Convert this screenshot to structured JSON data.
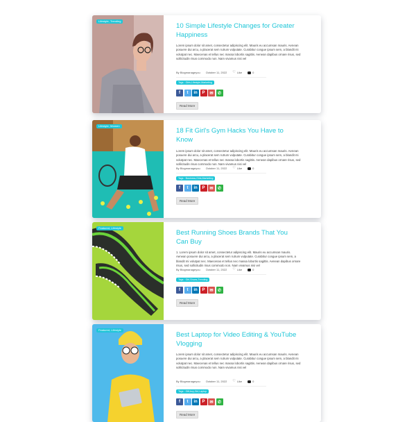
{
  "posts": [
    {
      "category": "Lifestyle, Trending",
      "title": "10 Simple Lifestyle Changes for Greater Happiness",
      "excerpt": "Lorem ipsum dolor sit amet, consectetur adipiscing elit. Mauris eu accumsan mauris. Aenean posuere dui arcu, a placerat sem rutrum vulputate. Curabitur congue ipsum sem, a blandit mi volutpat nec. Maecenas et tellus nec massa lobortis sagittis. Aenean dapibus ornare risus, sed sollicitudin risus commodo non. Nam vivamus nisi vel",
      "author": "By Blogmanageyou",
      "date": "October 11, 2022",
      "likes": "Like",
      "comments": "0",
      "tags": "Tags : Girls,Lifestyle,Marketing",
      "read_more": "Read More"
    },
    {
      "category": "Lifestyle, Women",
      "title": "18 Fit Girl's Gym Hacks You Have to Know",
      "excerpt": "Lorem ipsum dolor sit amet, consectetur adipiscing elit. Mauris eu accumsan mauris. Aenean posuere dui arcu, a placerat sem rutrum vulputate. Curabitur congue ipsum sem, a blandit mi volutpat nec. Maecenas et tellus nec massa lobortis sagittis. Aenean dapibus ornare risus, sed sollicitudin risus commodo non. Nam vivamus nisi vel",
      "author": "By Blogmanageyou",
      "date": "October 11, 2022",
      "likes": "Like",
      "comments": "0",
      "tags": "Tags : Business,Girls,Marketing",
      "read_more": "Read More"
    },
    {
      "category": "Featured, Lifestyle",
      "title": "Best Running Shoes Brands That You Can Buy",
      "excerpt": "1. Lorem ipsum dolor sit amet, consectetur adipiscing elit. Mauris eu accumsan mauris. Aenean posuere dui arcu, a placerat sem rutrum vulputate. Curabitur congue ipsum sem, a blandit mi volutpat nec. Maecenas et tellus nec massa lobortis sagittis. Aenean dapibus ornare risus, sed sollicitudin risus commodo non. Nam vivamus nisi vel",
      "author": "By Blogmanageyou",
      "date": "October 11, 2022",
      "likes": "Like",
      "comments": "0",
      "tags": "Tags : Girl,Shoes,Trending",
      "read_more": "Read More"
    },
    {
      "category": "Featured, Lifestyle",
      "title": "Best Laptop for Video Editing & YouTube Vlogging",
      "excerpt": "Lorem ipsum dolor sit amet, consectetur adipiscing elit. Mauris eu accumsan mauris. Aenean posuere dui arcu, a placerat sem rutrum vulputate. Curabitur congue ipsum sem, a blandit mi volutpat nec. Maecenas et tellus nec massa lobortis sagittis. Aenean dapibus ornare risus, sed sollicitudin risus commodo non. Nam vivamus nisi vel",
      "author": "By Blogmanageyou",
      "date": "October 11, 2022",
      "likes": "Like",
      "comments": "0",
      "tags": "Tags : Gift,buy,Girl,Laptop",
      "read_more": "Read More"
    }
  ],
  "share_icons": [
    "facebook-icon",
    "twitter-icon",
    "linkedin-icon",
    "pinterest-icon",
    "email-icon",
    "whatsapp-icon"
  ],
  "colors": {
    "accent": "#1ec6d8",
    "facebook": "#3b5998",
    "twitter": "#55acee",
    "linkedin": "#0077b5",
    "pinterest": "#cb2027",
    "email": "#d9534f",
    "whatsapp": "#2fb344"
  }
}
